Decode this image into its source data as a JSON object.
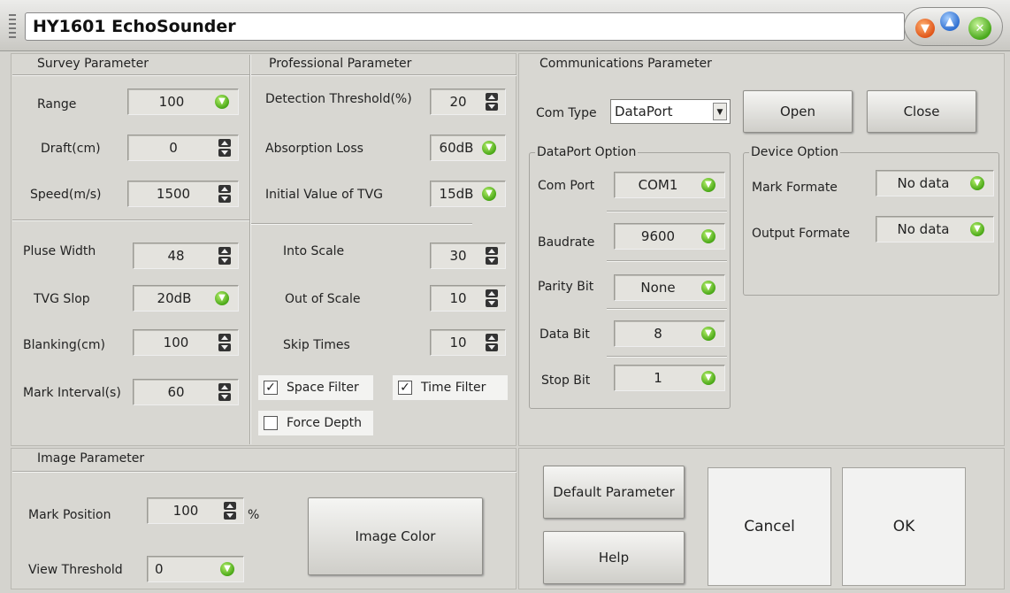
{
  "window": {
    "title": "HY1601 EchoSounder"
  },
  "survey": {
    "title": "Survey Parameter",
    "range": {
      "label": "Range",
      "value": "100"
    },
    "draft": {
      "label": "Draft(cm)",
      "value": "0"
    },
    "speed": {
      "label": "Speed(m/s)",
      "value": "1500"
    },
    "pulse_width": {
      "label": "Pluse Width",
      "value": "48"
    },
    "tvg_slop": {
      "label": "TVG Slop",
      "value": "20dB"
    },
    "blanking": {
      "label": "Blanking(cm)",
      "value": "100"
    },
    "mark_interval": {
      "label": "Mark Interval(s)",
      "value": "60"
    }
  },
  "professional": {
    "title": "Professional Parameter",
    "detection_threshold": {
      "label": "Detection Threshold(%)",
      "value": "20"
    },
    "absorption_loss": {
      "label": "Absorption Loss",
      "value": "60dB"
    },
    "initial_tvg": {
      "label": "Initial Value of TVG",
      "value": "15dB"
    },
    "into_scale": {
      "label": "Into Scale",
      "value": "30"
    },
    "out_of_scale": {
      "label": "Out of Scale",
      "value": "10"
    },
    "skip_times": {
      "label": "Skip Times",
      "value": "10"
    },
    "space_filter": {
      "label": "Space Filter",
      "checked": true
    },
    "time_filter": {
      "label": "Time Filter",
      "checked": true
    },
    "force_depth": {
      "label": "Force Depth",
      "checked": false
    }
  },
  "communications": {
    "title": "Communications Parameter",
    "com_type": {
      "label": "Com Type",
      "value": "DataPort"
    },
    "open_label": "Open",
    "close_label": "Close",
    "dataport": {
      "title": "DataPort Option",
      "com_port": {
        "label": "Com Port",
        "value": "COM1"
      },
      "baudrate": {
        "label": "Baudrate",
        "value": "9600"
      },
      "parity_bit": {
        "label": "Parity Bit",
        "value": "None"
      },
      "data_bit": {
        "label": "Data Bit",
        "value": "8"
      },
      "stop_bit": {
        "label": "Stop Bit",
        "value": "1"
      }
    },
    "device": {
      "title": "Device Option",
      "mark_formate": {
        "label": "Mark Formate",
        "value": "No data"
      },
      "output_formate": {
        "label": "Output Formate",
        "value": "No data"
      }
    }
  },
  "image": {
    "title": "Image Parameter",
    "mark_position": {
      "label": "Mark Position",
      "value": "100",
      "unit": "%"
    },
    "view_threshold": {
      "label": "View Threshold",
      "value": "0"
    },
    "image_color_label": "Image Color"
  },
  "actions": {
    "default_label": "Default Parameter",
    "help_label": "Help",
    "cancel_label": "Cancel",
    "ok_label": "OK"
  }
}
